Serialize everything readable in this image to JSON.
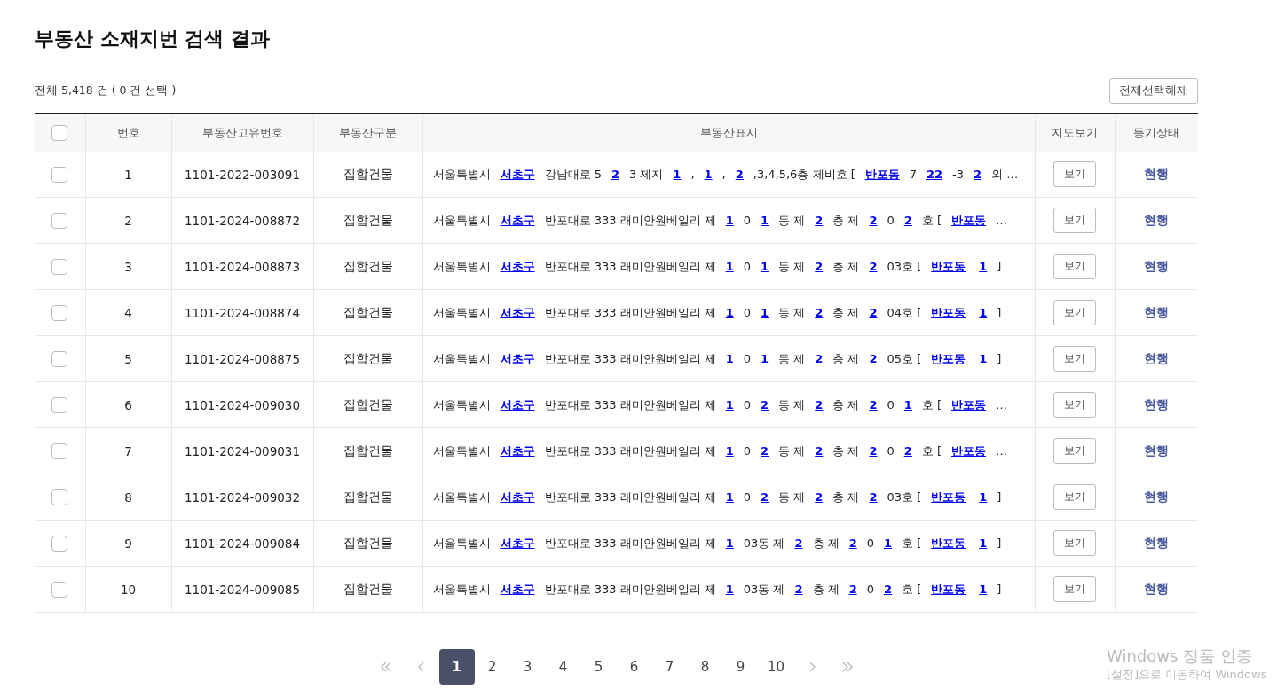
{
  "title": "부동산 소재지번 검색 결과",
  "summary": "전체 5,418 건 ( 0 건 선택 )",
  "deselect_button": "전제선택해제",
  "table": {
    "select_all": {
      "checked": false
    },
    "columns": [
      "번호",
      "부동산고유번호",
      "부동산구분",
      "부동산표시",
      "지도보기",
      "등기상태"
    ],
    "rows": [
      {
        "checked": false,
        "no": "1",
        "id": "1101-2022-003091",
        "type": "집합건물",
        "address": [
          {
            "t": "서울특별시",
            "link": false
          },
          {
            "t": "서초구",
            "link": true
          },
          {
            "t": "강남대로 5",
            "link": false
          },
          {
            "t": "2",
            "link": true
          },
          {
            "t": "3 제지",
            "link": false
          },
          {
            "t": "1",
            "link": true
          },
          {
            "t": ",",
            "link": false
          },
          {
            "t": "1",
            "link": true
          },
          {
            "t": ",",
            "link": false
          },
          {
            "t": "2",
            "link": true
          },
          {
            "t": ",3,4,5,6층 제비호 [",
            "link": false
          },
          {
            "t": "반포동",
            "link": true
          },
          {
            "t": "7",
            "link": false
          },
          {
            "t": "22",
            "link": true
          },
          {
            "t": "-3",
            "link": false
          },
          {
            "t": "2",
            "link": true
          },
          {
            "t": "외 …",
            "link": false
          }
        ],
        "map": "보기",
        "status": "현행"
      },
      {
        "checked": false,
        "no": "2",
        "id": "1101-2024-008872",
        "type": "집합건물",
        "address": [
          {
            "t": "서울특별시",
            "link": false
          },
          {
            "t": "서초구",
            "link": true
          },
          {
            "t": "반포대로 333 래미안원베일리 제",
            "link": false
          },
          {
            "t": "1",
            "link": true
          },
          {
            "t": "0",
            "link": false
          },
          {
            "t": "1",
            "link": true
          },
          {
            "t": "동 제",
            "link": false
          },
          {
            "t": "2",
            "link": true
          },
          {
            "t": "층 제",
            "link": false
          },
          {
            "t": "2",
            "link": true
          },
          {
            "t": "0",
            "link": false
          },
          {
            "t": "2",
            "link": true
          },
          {
            "t": "호 [",
            "link": false
          },
          {
            "t": "반포동",
            "link": true
          },
          {
            "t": "…",
            "link": false
          }
        ],
        "map": "보기",
        "status": "현행"
      },
      {
        "checked": false,
        "no": "3",
        "id": "1101-2024-008873",
        "type": "집합건물",
        "address": [
          {
            "t": "서울특별시",
            "link": false
          },
          {
            "t": "서초구",
            "link": true
          },
          {
            "t": "반포대로 333 래미안원베일리 제",
            "link": false
          },
          {
            "t": "1",
            "link": true
          },
          {
            "t": "0",
            "link": false
          },
          {
            "t": "1",
            "link": true
          },
          {
            "t": "동 제",
            "link": false
          },
          {
            "t": "2",
            "link": true
          },
          {
            "t": "층 제",
            "link": false
          },
          {
            "t": "2",
            "link": true
          },
          {
            "t": "03호 [",
            "link": false
          },
          {
            "t": "반포동",
            "link": true
          },
          {
            "t": "1",
            "link": true
          },
          {
            "t": "]",
            "link": false
          }
        ],
        "map": "보기",
        "status": "현행"
      },
      {
        "checked": false,
        "no": "4",
        "id": "1101-2024-008874",
        "type": "집합건물",
        "address": [
          {
            "t": "서울특별시",
            "link": false
          },
          {
            "t": "서초구",
            "link": true
          },
          {
            "t": "반포대로 333 래미안원베일리 제",
            "link": false
          },
          {
            "t": "1",
            "link": true
          },
          {
            "t": "0",
            "link": false
          },
          {
            "t": "1",
            "link": true
          },
          {
            "t": "동 제",
            "link": false
          },
          {
            "t": "2",
            "link": true
          },
          {
            "t": "층 제",
            "link": false
          },
          {
            "t": "2",
            "link": true
          },
          {
            "t": "04호 [",
            "link": false
          },
          {
            "t": "반포동",
            "link": true
          },
          {
            "t": "1",
            "link": true
          },
          {
            "t": "]",
            "link": false
          }
        ],
        "map": "보기",
        "status": "현행"
      },
      {
        "checked": false,
        "no": "5",
        "id": "1101-2024-008875",
        "type": "집합건물",
        "address": [
          {
            "t": "서울특별시",
            "link": false
          },
          {
            "t": "서초구",
            "link": true
          },
          {
            "t": "반포대로 333 래미안원베일리 제",
            "link": false
          },
          {
            "t": "1",
            "link": true
          },
          {
            "t": "0",
            "link": false
          },
          {
            "t": "1",
            "link": true
          },
          {
            "t": "동 제",
            "link": false
          },
          {
            "t": "2",
            "link": true
          },
          {
            "t": "층 제",
            "link": false
          },
          {
            "t": "2",
            "link": true
          },
          {
            "t": "05호 [",
            "link": false
          },
          {
            "t": "반포동",
            "link": true
          },
          {
            "t": "1",
            "link": true
          },
          {
            "t": "]",
            "link": false
          }
        ],
        "map": "보기",
        "status": "현행"
      },
      {
        "checked": false,
        "no": "6",
        "id": "1101-2024-009030",
        "type": "집합건물",
        "address": [
          {
            "t": "서울특별시",
            "link": false
          },
          {
            "t": "서초구",
            "link": true
          },
          {
            "t": "반포대로 333 래미안원베일리 제",
            "link": false
          },
          {
            "t": "1",
            "link": true
          },
          {
            "t": "0",
            "link": false
          },
          {
            "t": "2",
            "link": true
          },
          {
            "t": "동 제",
            "link": false
          },
          {
            "t": "2",
            "link": true
          },
          {
            "t": "층 제",
            "link": false
          },
          {
            "t": "2",
            "link": true
          },
          {
            "t": "0",
            "link": false
          },
          {
            "t": "1",
            "link": true
          },
          {
            "t": "호 [",
            "link": false
          },
          {
            "t": "반포동",
            "link": true
          },
          {
            "t": "…",
            "link": false
          }
        ],
        "map": "보기",
        "status": "현행"
      },
      {
        "checked": false,
        "no": "7",
        "id": "1101-2024-009031",
        "type": "집합건물",
        "address": [
          {
            "t": "서울특별시",
            "link": false
          },
          {
            "t": "서초구",
            "link": true
          },
          {
            "t": "반포대로 333 래미안원베일리 제",
            "link": false
          },
          {
            "t": "1",
            "link": true
          },
          {
            "t": "0",
            "link": false
          },
          {
            "t": "2",
            "link": true
          },
          {
            "t": "동 제",
            "link": false
          },
          {
            "t": "2",
            "link": true
          },
          {
            "t": "층 제",
            "link": false
          },
          {
            "t": "2",
            "link": true
          },
          {
            "t": "0",
            "link": false
          },
          {
            "t": "2",
            "link": true
          },
          {
            "t": "호 [",
            "link": false
          },
          {
            "t": "반포동",
            "link": true
          },
          {
            "t": "…",
            "link": false
          }
        ],
        "map": "보기",
        "status": "현행"
      },
      {
        "checked": false,
        "no": "8",
        "id": "1101-2024-009032",
        "type": "집합건물",
        "address": [
          {
            "t": "서울특별시",
            "link": false
          },
          {
            "t": "서초구",
            "link": true
          },
          {
            "t": "반포대로 333 래미안원베일리 제",
            "link": false
          },
          {
            "t": "1",
            "link": true
          },
          {
            "t": "0",
            "link": false
          },
          {
            "t": "2",
            "link": true
          },
          {
            "t": "동 제",
            "link": false
          },
          {
            "t": "2",
            "link": true
          },
          {
            "t": "층 제",
            "link": false
          },
          {
            "t": "2",
            "link": true
          },
          {
            "t": "03호 [",
            "link": false
          },
          {
            "t": "반포동",
            "link": true
          },
          {
            "t": "1",
            "link": true
          },
          {
            "t": "]",
            "link": false
          }
        ],
        "map": "보기",
        "status": "현행"
      },
      {
        "checked": false,
        "no": "9",
        "id": "1101-2024-009084",
        "type": "집합건물",
        "address": [
          {
            "t": "서울특별시",
            "link": false
          },
          {
            "t": "서초구",
            "link": true
          },
          {
            "t": "반포대로 333 래미안원베일리 제",
            "link": false
          },
          {
            "t": "1",
            "link": true
          },
          {
            "t": "03동 제",
            "link": false
          },
          {
            "t": "2",
            "link": true
          },
          {
            "t": "층 제",
            "link": false
          },
          {
            "t": "2",
            "link": true
          },
          {
            "t": "0",
            "link": false
          },
          {
            "t": "1",
            "link": true
          },
          {
            "t": "호 [",
            "link": false
          },
          {
            "t": "반포동",
            "link": true
          },
          {
            "t": "1",
            "link": true
          },
          {
            "t": "]",
            "link": false
          }
        ],
        "map": "보기",
        "status": "현행"
      },
      {
        "checked": false,
        "no": "10",
        "id": "1101-2024-009085",
        "type": "집합건물",
        "address": [
          {
            "t": "서울특별시",
            "link": false
          },
          {
            "t": "서초구",
            "link": true
          },
          {
            "t": "반포대로 333 래미안원베일리 제",
            "link": false
          },
          {
            "t": "1",
            "link": true
          },
          {
            "t": "03동 제",
            "link": false
          },
          {
            "t": "2",
            "link": true
          },
          {
            "t": "층 제",
            "link": false
          },
          {
            "t": "2",
            "link": true
          },
          {
            "t": "0",
            "link": false
          },
          {
            "t": "2",
            "link": true
          },
          {
            "t": "호 [",
            "link": false
          },
          {
            "t": "반포동",
            "link": true
          },
          {
            "t": "1",
            "link": true
          },
          {
            "t": "]",
            "link": false
          }
        ],
        "map": "보기",
        "status": "현행"
      }
    ]
  },
  "pagination": {
    "pages": [
      {
        "label": "1",
        "selected": true
      },
      {
        "label": "2",
        "selected": false
      },
      {
        "label": "3",
        "selected": false
      },
      {
        "label": "4",
        "selected": false
      },
      {
        "label": "5",
        "selected": false
      },
      {
        "label": "6",
        "selected": false
      },
      {
        "label": "7",
        "selected": false
      },
      {
        "label": "8",
        "selected": false
      },
      {
        "label": "9",
        "selected": false
      },
      {
        "label": "10",
        "selected": false
      }
    ]
  },
  "activation_notice": {
    "title": "Windows 정품 인증",
    "hint": "[설정]으로 이동하여 Windows"
  }
}
